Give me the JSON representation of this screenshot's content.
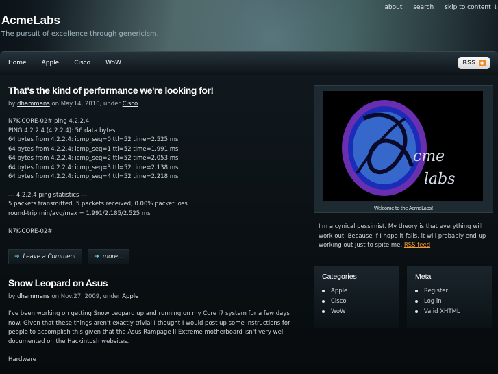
{
  "header": {
    "site_title": "AcmeLabs",
    "tagline": "The pursuit of excellence through genericism.",
    "top_links": [
      "about",
      "search",
      "skip to content ↓"
    ]
  },
  "nav": {
    "items": [
      "Home",
      "Apple",
      "Cisco",
      "WoW"
    ],
    "rss_label": "RSS"
  },
  "posts": [
    {
      "title": "That's the kind of performance we're looking for!",
      "meta_by": "by ",
      "author": "dhammans",
      "meta_on": " on May.14, 2010, under ",
      "category": "Cisco",
      "lines": [
        "N7K-CORE-02# ping 4.2.2.4",
        "PING 4.2.2.4 (4.2.2.4): 56 data bytes",
        "64 bytes from 4.2.2.4: icmp_seq=0 ttl=52 time=2.525 ms",
        "64 bytes from 4.2.2.4: icmp_seq=1 ttl=52 time=1.991 ms",
        "64 bytes from 4.2.2.4: icmp_seq=2 ttl=52 time=2.053 ms",
        "64 bytes from 4.2.2.4: icmp_seq=3 ttl=52 time=2.138 ms",
        "64 bytes from 4.2.2.4: icmp_seq=4 ttl=52 time=2.218 ms",
        "--- 4.2.2.4 ping statistics ---",
        "5 packets transmitted, 5 packets received, 0.00% packet loss",
        "round-trip min/avg/max = 1.991/2.185/2.525 ms",
        "N7K-CORE-02#"
      ],
      "comment_label": "Leave a Comment",
      "more_label": "more..."
    },
    {
      "title": "Snow Leopard on Asus",
      "meta_by": "by ",
      "author": "dhammans",
      "meta_on": " on Nov.27, 2009, under ",
      "category": "Apple",
      "paragraph": "I've been working on getting Snow Leopard up and running on my Core i7 system for a few days now. Given that these things aren't exactly trivial I thought I would post up some instructions for people to accomplish this given that the Asus Rampage II Extreme motherboard isn't very well documented on the Hackintosh websites.",
      "subheading": "Hardware"
    }
  ],
  "sidebar": {
    "logo_text_top": "cme",
    "logo_text_bottom": "labs",
    "logo_caption": "Welcome to the AcmeLabs!",
    "about_text": "I'm a cynical pessimist. My theory is that everything will work out. Because if I hope it fails, it will probably end up working out just to spite me. ",
    "about_link": "RSS feed"
  },
  "widgets": {
    "categories": {
      "title": "Categories",
      "items": [
        "Apple",
        "Cisco",
        "WoW"
      ]
    },
    "meta": {
      "title": "Meta",
      "items": [
        "Register",
        "Log in",
        "Valid XHTML"
      ]
    }
  },
  "colors": {
    "accent_link": "#f29b35",
    "arrow": "#6ec0e8",
    "logo_ring": "#6a2fb0"
  }
}
